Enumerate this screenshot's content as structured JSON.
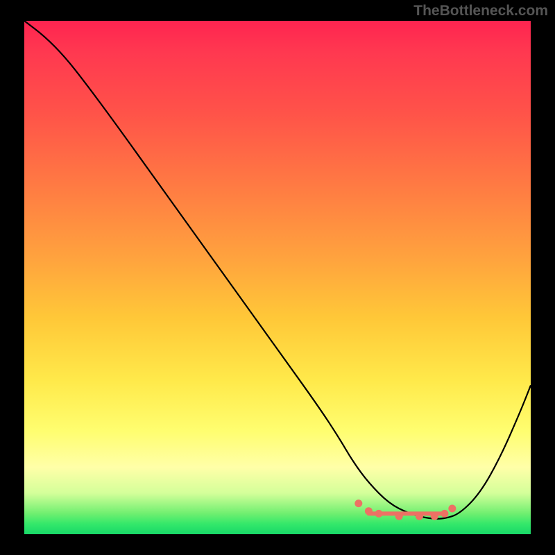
{
  "watermark": "TheBottleneck.com",
  "chart_data": {
    "type": "line",
    "title": "",
    "xlabel": "",
    "ylabel": "",
    "xlim": [
      0,
      100
    ],
    "ylim": [
      0,
      100
    ],
    "grid": false,
    "series": [
      {
        "name": "bottleneck-curve",
        "x": [
          0,
          4,
          8,
          12,
          18,
          26,
          34,
          42,
          50,
          58,
          62,
          65,
          68,
          72,
          76,
          80,
          83,
          86,
          90,
          94,
          98,
          100
        ],
        "y": [
          100,
          97,
          93,
          88,
          80,
          69,
          58,
          47,
          36,
          25,
          19,
          14,
          10,
          6,
          4,
          3,
          3,
          4,
          8,
          15,
          24,
          29
        ]
      }
    ],
    "optimal_flat": {
      "x_start": 68,
      "x_end": 83,
      "y": 4
    },
    "marker_dots": [
      {
        "x": 66,
        "y": 6
      },
      {
        "x": 68,
        "y": 4.5
      },
      {
        "x": 70,
        "y": 4
      },
      {
        "x": 74,
        "y": 3.5
      },
      {
        "x": 78,
        "y": 3.5
      },
      {
        "x": 81,
        "y": 3.5
      },
      {
        "x": 83,
        "y": 4
      },
      {
        "x": 84.5,
        "y": 5
      }
    ]
  }
}
